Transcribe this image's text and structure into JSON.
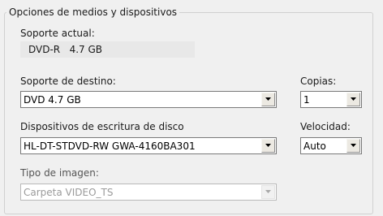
{
  "group_title": "Opciones de medios y dispositivos",
  "current_media": {
    "label": "Soporte actual:",
    "value": "DVD-R   4.7 GB"
  },
  "target_media": {
    "label": "Soporte de destino:",
    "value": "DVD 4.7 GB"
  },
  "copies": {
    "label": "Copias:",
    "value": "1"
  },
  "writer": {
    "label": "Dispositivos de escritura de disco",
    "value": "HL-DT-STDVD-RW GWA-4160BA301"
  },
  "speed": {
    "label": "Velocidad:",
    "value": "Auto"
  },
  "image_type": {
    "label": "Tipo de imagen:",
    "value": "Carpeta VIDEO_TS",
    "enabled": false
  }
}
